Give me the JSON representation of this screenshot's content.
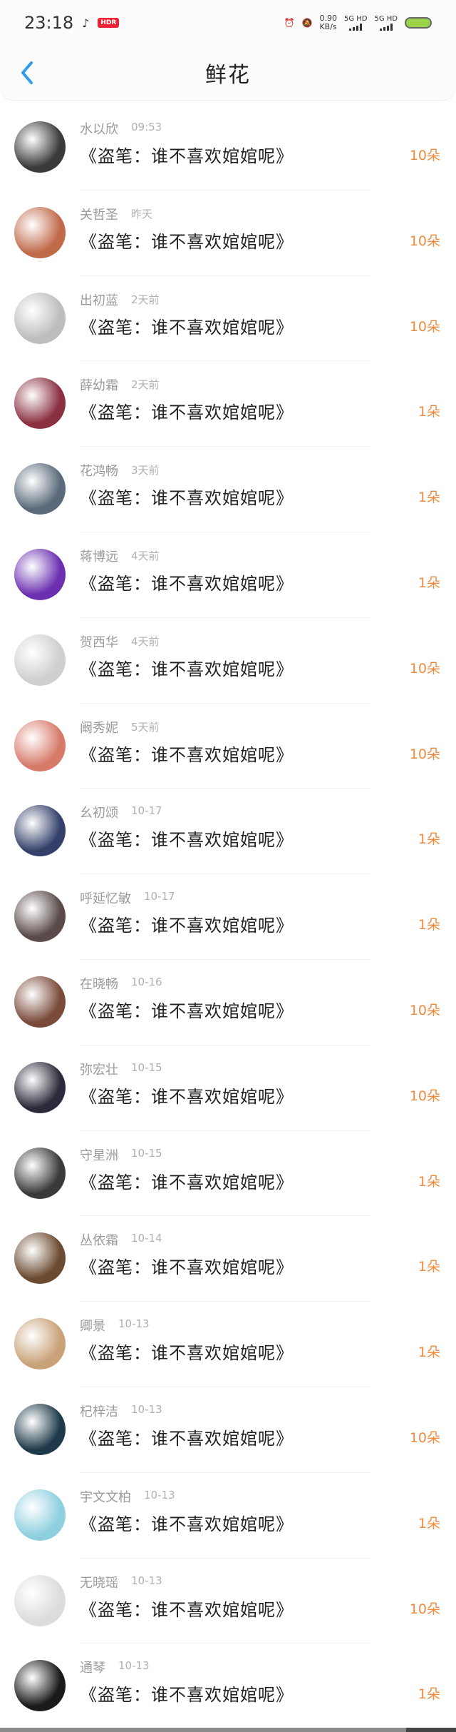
{
  "status_bar": {
    "time": "23:18",
    "speed": "0.90",
    "speed_unit": "KB/s",
    "signal1": "5G HD",
    "signal2": "5G HD",
    "hdr_badge": "HDR"
  },
  "header": {
    "title": "鲜花",
    "back_icon": "chevron-left-icon",
    "accent": "#2d9cf0"
  },
  "colors": {
    "count": "#f08a3c"
  },
  "items": [
    {
      "name": "水以欣",
      "time": "09:53",
      "message": "《盗笔：谁不喜欢婠婠呢》",
      "count": "10朵",
      "avatar": "#3a3a3a"
    },
    {
      "name": "关哲圣",
      "time": "昨天",
      "message": "《盗笔：谁不喜欢婠婠呢》",
      "count": "10朵",
      "avatar": "#c06a4a"
    },
    {
      "name": "出初蓝",
      "time": "2天前",
      "message": "《盗笔：谁不喜欢婠婠呢》",
      "count": "10朵",
      "avatar": "#bdbdbd"
    },
    {
      "name": "薛幼霜",
      "time": "2天前",
      "message": "《盗笔：谁不喜欢婠婠呢》",
      "count": "1朵",
      "avatar": "#8a3040"
    },
    {
      "name": "花鸿畅",
      "time": "3天前",
      "message": "《盗笔：谁不喜欢婠婠呢》",
      "count": "1朵",
      "avatar": "#5a6a7a"
    },
    {
      "name": "蒋博远",
      "time": "4天前",
      "message": "《盗笔：谁不喜欢婠婠呢》",
      "count": "1朵",
      "avatar": "#6b2fb0"
    },
    {
      "name": "贺西华",
      "time": "4天前",
      "message": "《盗笔：谁不喜欢婠婠呢》",
      "count": "10朵",
      "avatar": "#cfcfcf"
    },
    {
      "name": "阚秀妮",
      "time": "5天前",
      "message": "《盗笔：谁不喜欢婠婠呢》",
      "count": "10朵",
      "avatar": "#d77a6a"
    },
    {
      "name": "幺初颂",
      "time": "10-17",
      "message": "《盗笔：谁不喜欢婠婠呢》",
      "count": "1朵",
      "avatar": "#33406a"
    },
    {
      "name": "呼延忆敏",
      "time": "10-17",
      "message": "《盗笔：谁不喜欢婠婠呢》",
      "count": "1朵",
      "avatar": "#5a4a4a"
    },
    {
      "name": "在晓畅",
      "time": "10-16",
      "message": "《盗笔：谁不喜欢婠婠呢》",
      "count": "10朵",
      "avatar": "#7a4a3a"
    },
    {
      "name": "弥宏壮",
      "time": "10-15",
      "message": "《盗笔：谁不喜欢婠婠呢》",
      "count": "10朵",
      "avatar": "#2a2a3a"
    },
    {
      "name": "守星洲",
      "time": "10-15",
      "message": "《盗笔：谁不喜欢婠婠呢》",
      "count": "1朵",
      "avatar": "#3a3a3a"
    },
    {
      "name": "丛依霜",
      "time": "10-14",
      "message": "《盗笔：谁不喜欢婠婠呢》",
      "count": "1朵",
      "avatar": "#6a4a30"
    },
    {
      "name": "卿景",
      "time": "10-13",
      "message": "《盗笔：谁不喜欢婠婠呢》",
      "count": "1朵",
      "avatar": "#c9a27a"
    },
    {
      "name": "杞梓洁",
      "time": "10-13",
      "message": "《盗笔：谁不喜欢婠婠呢》",
      "count": "10朵",
      "avatar": "#1e3a4a"
    },
    {
      "name": "宇文文柏",
      "time": "10-13",
      "message": "《盗笔：谁不喜欢婠婠呢》",
      "count": "1朵",
      "avatar": "#8fd0e0"
    },
    {
      "name": "无晓瑶",
      "time": "10-13",
      "message": "《盗笔：谁不喜欢婠婠呢》",
      "count": "10朵",
      "avatar": "#dcdcdc"
    },
    {
      "name": "通琴",
      "time": "10-13",
      "message": "《盗笔：谁不喜欢婠婠呢》",
      "count": "1朵",
      "avatar": "#1a1a1a"
    }
  ]
}
